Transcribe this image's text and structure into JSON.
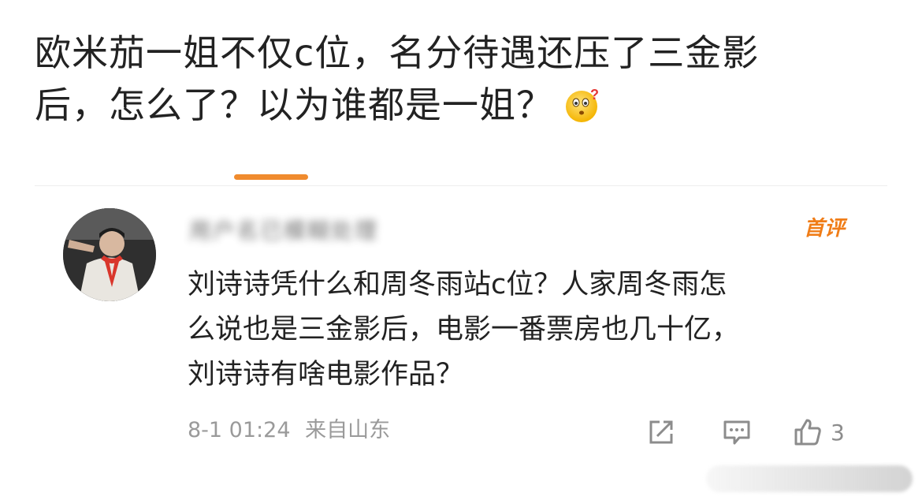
{
  "post": {
    "line1": "欧米茄一姐不仅c位，名分待遇还压了三金影",
    "line2": "后，怎么了？以为谁都是一姐？"
  },
  "emoji": "confused-face-emoji",
  "comment": {
    "username": "用户名已模糊处理",
    "badge": "首评",
    "text_line1": "刘诗诗凭什么和周冬雨站c位？人家周冬雨怎",
    "text_line2": "么说也是三金影后，电影一番票房也几十亿，",
    "text_line3": "刘诗诗有啥电影作品？",
    "timestamp": "8-1 01:24",
    "location": "来自山东",
    "like_count": "3"
  },
  "colors": {
    "accent": "#f08b2e",
    "badge": "#f07d18",
    "meta": "#9a9a9a"
  }
}
